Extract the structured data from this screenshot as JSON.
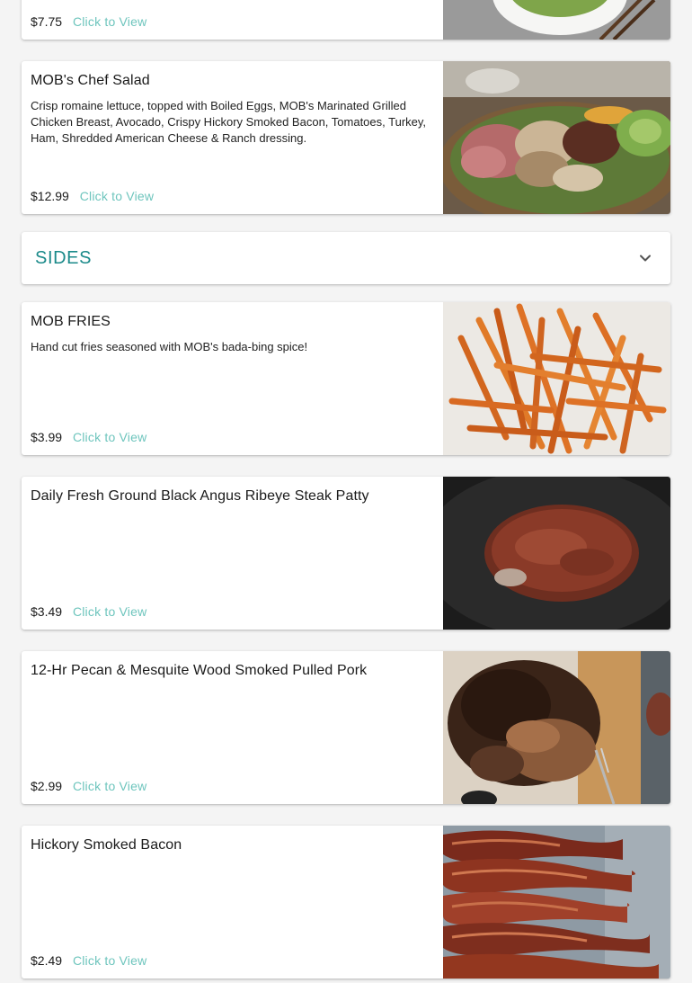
{
  "colors": {
    "accent": "#1b8a8a",
    "link": "#6ec5bd",
    "card_bg": "#ffffff",
    "page_bg": "#f4f4f4"
  },
  "top_item": {
    "price": "$7.75",
    "link_label": "Click to View"
  },
  "salad_item": {
    "title": "MOB's Chef Salad",
    "description": "Crisp romaine lettuce, topped with Boiled Eggs, MOB's Marinated Grilled Chicken Breast, Avocado, Crispy Hickory Smoked Bacon, Tomatoes, Turkey, Ham, Shredded American Cheese & Ranch dressing.",
    "price": "$12.99",
    "link_label": "Click to View"
  },
  "sides_section": {
    "title": "SIDES",
    "icon": "chevron-down-icon"
  },
  "sides": [
    {
      "title": "MOB FRIES",
      "description": "Hand cut fries seasoned with MOB's bada-bing spice!",
      "price": "$3.99",
      "link_label": "Click to View"
    },
    {
      "title": "Daily Fresh Ground Black Angus Ribeye Steak Patty",
      "description": "",
      "price": "$3.49",
      "link_label": "Click to View"
    },
    {
      "title": "12-Hr Pecan & Mesquite Wood Smoked Pulled Pork",
      "description": "",
      "price": "$2.99",
      "link_label": "Click to View"
    },
    {
      "title": "Hickory Smoked Bacon",
      "description": "",
      "price": "$2.49",
      "link_label": "Click to View"
    }
  ]
}
